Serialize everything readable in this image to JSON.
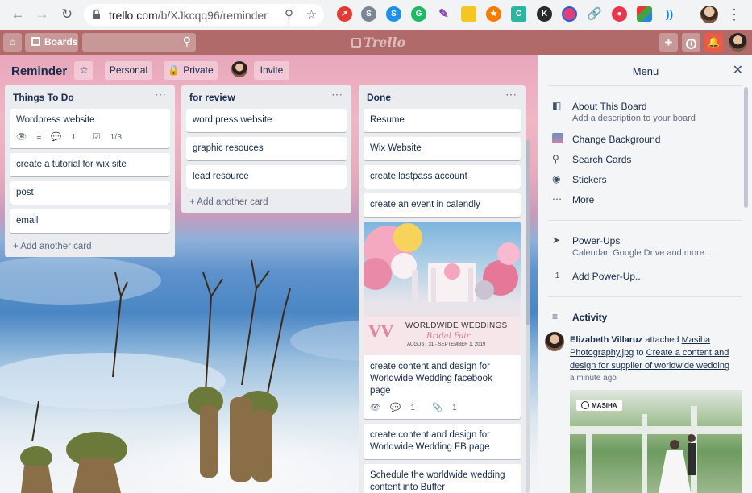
{
  "browser": {
    "url_host": "trello.com",
    "url_path": "/b/XJkcqq96/reminder"
  },
  "header": {
    "boards_label": "Boards",
    "logo_text": "Trello"
  },
  "board": {
    "title": "Reminder",
    "visibility_team": "Personal",
    "visibility": "Private",
    "invite_label": "Invite",
    "colors": {
      "header": "#b06a6a",
      "list_bg": "#ebecf0"
    }
  },
  "lists": [
    {
      "title": "Things To Do",
      "cards": [
        {
          "text": "Wordpress website",
          "badges": {
            "comments": "1",
            "checklist": "1/3"
          }
        },
        {
          "text": "create a tutorial for wix site"
        },
        {
          "text": "post"
        },
        {
          "text": "email"
        }
      ],
      "add_label": "Add another card"
    },
    {
      "title": "for review",
      "cards": [
        {
          "text": "word press website"
        },
        {
          "text": "graphic resouces"
        },
        {
          "text": "lead resource"
        }
      ],
      "add_label": "Add another card"
    },
    {
      "title": "Done",
      "cards": [
        {
          "text": "Resume"
        },
        {
          "text": "Wix Website"
        },
        {
          "text": "create lastpass account"
        },
        {
          "text": "create an event in calendly"
        },
        {
          "image": {
            "headline": "WORLDWIDE WEDDINGS",
            "subline": "Bridal Fair",
            "dates": "AUGUST 31 - SEPTEMBER 1, 2019"
          },
          "text": "create content and design for Worldwide Wedding facebook page",
          "badges": {
            "comments": "1",
            "attachments": "1"
          }
        },
        {
          "text": "create content and design for Worldwide Wedding FB page"
        },
        {
          "text": "Schedule the worldwide wedding content into Buffer"
        }
      ]
    }
  ],
  "menu": {
    "title": "Menu",
    "about_title": "About This Board",
    "about_sub": "Add a description to your board",
    "change_bg": "Change Background",
    "search_cards": "Search Cards",
    "stickers": "Stickers",
    "more": "More",
    "powerups_title": "Power-Ups",
    "powerups_sub": "Calendar, Google Drive and more...",
    "powerups_count": "1",
    "add_powerup": "Add Power-Up...",
    "activity_title": "Activity",
    "activity": {
      "user": "Elizabeth Villaruz",
      "verb": "attached",
      "attachment": "Masiha Photography.jpg",
      "to": "to",
      "card": "Create a content and design for supplier of worldwide wedding",
      "time": "a minute ago",
      "image_brand": "MASIHA"
    }
  }
}
